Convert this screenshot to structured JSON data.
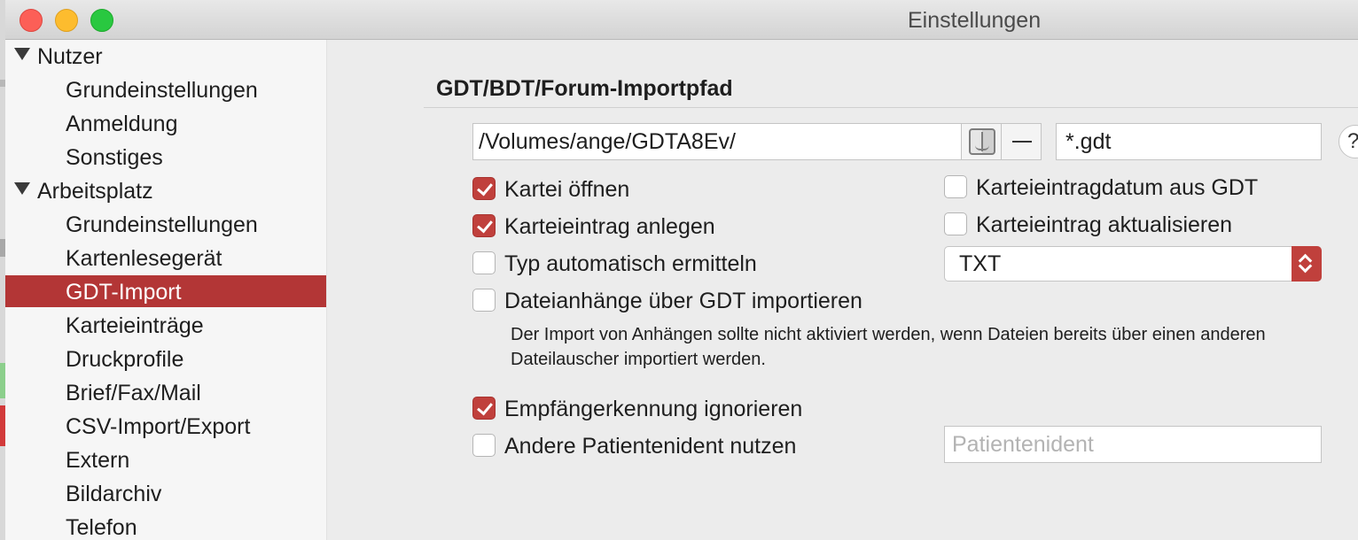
{
  "window": {
    "title": "Einstellungen"
  },
  "sidebar": {
    "groups": [
      {
        "label": "Nutzer",
        "items": [
          "Grundeinstellungen",
          "Anmeldung",
          "Sonstiges"
        ]
      },
      {
        "label": "Arbeitsplatz",
        "items": [
          "Grundeinstellungen",
          "Kartenlesegerät",
          "GDT-Import",
          "Karteieinträge",
          "Druckprofile",
          "Brief/Fax/Mail",
          "CSV-Import/Export",
          "Extern",
          "Bildarchiv",
          "Telefon"
        ]
      }
    ],
    "selected": "GDT-Import"
  },
  "main": {
    "section_title": "GDT/BDT/Forum-Importpfad",
    "path_value": "/Volumes/ange/GDTA8Ev/",
    "extension_value": "*.gdt",
    "help_label": "?",
    "checkboxes": {
      "kartei_oeffnen": {
        "label": "Kartei öffnen",
        "checked": true
      },
      "karteieintrag_anlegen": {
        "label": "Karteieintrag anlegen",
        "checked": true
      },
      "typ_automatisch": {
        "label": "Typ automatisch ermitteln",
        "checked": false
      },
      "dateianhaenge": {
        "label": "Dateianhänge über GDT importieren",
        "checked": false
      },
      "karteieintragdatum": {
        "label": "Karteieintragdatum aus GDT",
        "checked": false
      },
      "karteieintrag_aktualisieren": {
        "label": "Karteieintrag aktualisieren",
        "checked": false
      },
      "empfaengerkennung": {
        "label": "Empfängerkennung ignorieren",
        "checked": true
      },
      "andere_patientenident": {
        "label": "Andere Patientenident nutzen",
        "checked": false
      }
    },
    "type_select": {
      "value": "TXT"
    },
    "note": "Der Import von Anhängen sollte nicht aktiviert werden, wenn Dateien bereits über einen anderen Dateilauscher importiert werden.",
    "patientenident_placeholder": "Patientenident"
  },
  "colors": {
    "accent": "#b33636",
    "checkbox_checked": "#c0403c",
    "sidebar_bg": "#f6f6f6",
    "window_bg": "#ececec"
  },
  "icons": {
    "close": "close-traffic-light",
    "minimize": "minimize-traffic-light",
    "maximize": "zoom-traffic-light",
    "finder": "finder-icon",
    "minus": "minus-icon",
    "disclosure": "disclosure-triangle-icon",
    "popup": "chevron-up-down-icon"
  }
}
